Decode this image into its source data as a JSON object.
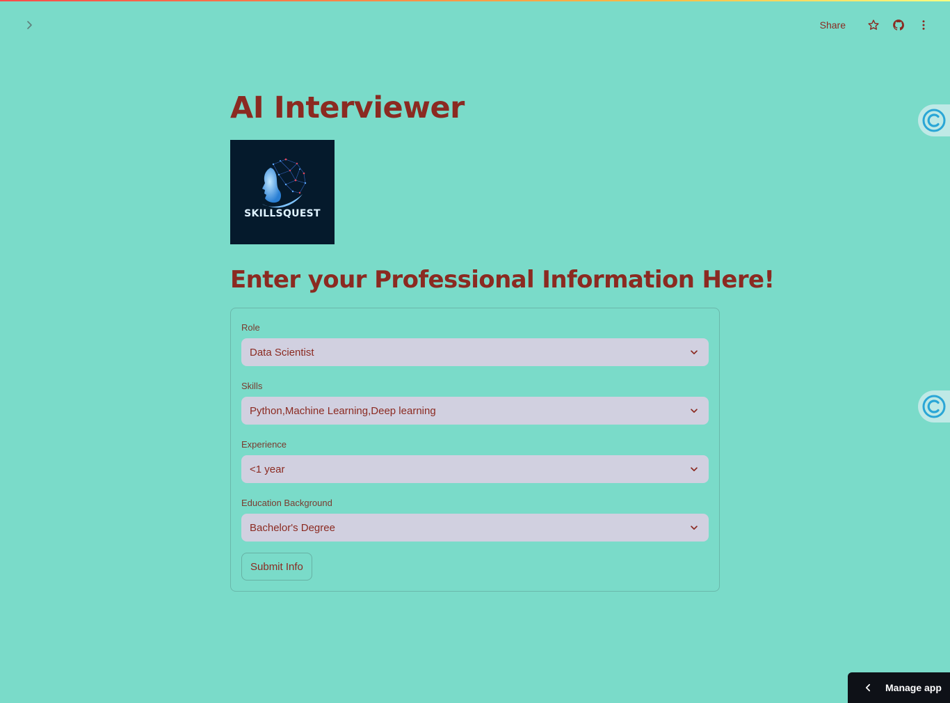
{
  "header": {
    "share_label": "Share"
  },
  "main": {
    "title": "AI Interviewer",
    "logo_text": "SKILLSQUEST",
    "subheader": "Enter your Professional Information Here!"
  },
  "form": {
    "role": {
      "label": "Role",
      "value": "Data Scientist"
    },
    "skills": {
      "label": "Skills",
      "value": "Python,Machine Learning,Deep learning"
    },
    "experience": {
      "label": "Experience",
      "value": "<1 year"
    },
    "education": {
      "label": "Education Background",
      "value": "Bachelor's Degree"
    },
    "submit_label": "Submit Info"
  },
  "footer": {
    "manage_app_label": "Manage app"
  },
  "icons": {
    "sidebar_toggle": "chevron-right-icon",
    "star": "star-icon",
    "github": "github-icon",
    "menu": "more-vertical-icon",
    "dropdown": "chevron-down-icon",
    "side_widget": "c-logo-icon",
    "manage_app": "chevron-left-icon"
  },
  "colors": {
    "background": "#7adbc9",
    "text": "#8b2a21",
    "select_bg": "#d1d0e0",
    "logo_bg": "#051a2c",
    "manage_app_bg": "#0e1117"
  }
}
